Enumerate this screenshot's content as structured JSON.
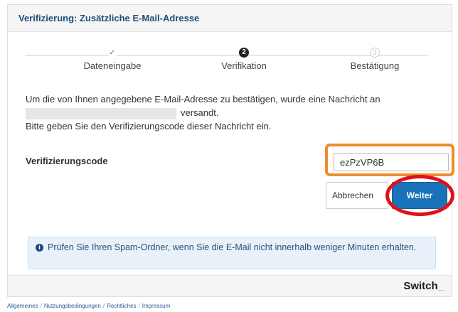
{
  "header": {
    "title": "Verifizierung: Zusätzliche E-Mail-Adresse"
  },
  "steps": [
    {
      "label": "Dateneingabe",
      "marker": "✓",
      "state": "done"
    },
    {
      "label": "Verifikation",
      "marker": "2",
      "state": "current"
    },
    {
      "label": "Bestätigung",
      "marker": "3",
      "state": "future"
    }
  ],
  "message": {
    "line1": "Um die von Ihnen angegebene E-Mail-Adresse zu bestätigen, wurde eine Nachricht an",
    "line2_suffix": "versandt.",
    "line3": "Bitte geben Sie den Verifizierungscode dieser Nachricht ein."
  },
  "form": {
    "code_label": "Verifizierungscode",
    "code_value": "ezPzVP6B",
    "cancel_label": "Abbrechen",
    "next_label": "Weiter"
  },
  "info": {
    "icon": "info-icon",
    "text": "Prüfen Sie Ihren Spam-Ordner, wenn Sie die E-Mail nicht innerhalb weniger Minuten erhalten."
  },
  "brand": {
    "name": "Switch",
    "underscore": "_"
  },
  "footer_links": [
    "Allgemeines",
    "Nutzungsbedingungen",
    "Rechtliches",
    "Impressum"
  ],
  "colors": {
    "accent": "#1a73b9",
    "highlight_orange": "#f08a2b",
    "highlight_red": "#e0111b"
  }
}
